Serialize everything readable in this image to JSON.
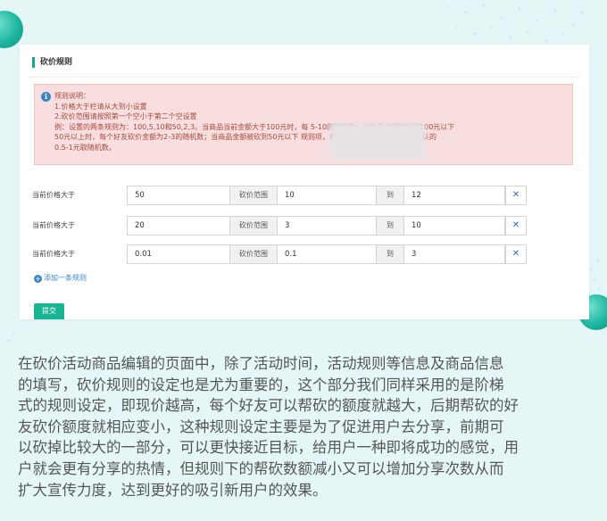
{
  "panel": {
    "title": "砍价规则",
    "notice_lines": [
      "规则说明：",
      "1.价格大于栏请从大到小设置",
      "2.砍价范围请按照第一个空小于第二个空设置",
      "例：设置的两条规则为：100,5,10和50,2,3。当商品当前金额大于100元时，每                            5-10的随机数；当商品金额被砍到100元以下",
      "50元以上时，每个好友砍价金额为2-3的随机数；当商品金额被砍到50元以下                            规则项，每个好友砍价金额为会按照默认的",
      "0.5-1元取随机数。"
    ]
  },
  "rules": [
    {
      "label": "当前价格大于",
      "price": "50",
      "range_label": "砍价范围",
      "min": "10",
      "to_label": "到",
      "max": "12"
    },
    {
      "label": "当前价格大于",
      "price": "20",
      "range_label": "砍价范围",
      "min": "3",
      "to_label": "到",
      "max": "10"
    },
    {
      "label": "当前价格大于",
      "price": "0.01",
      "range_label": "砍价范围",
      "min": "0.1",
      "to_label": "到",
      "max": "3"
    }
  ],
  "add_rule_label": "添加一条规则",
  "submit_label": "提交",
  "caption_lines": [
    "在砍价活动商品编辑的页面中，除了活动时间，活动规则等信息及商品信息",
    "的填写，砍价规则的设定也是尤为重要的，这个部分我们同样采用的是阶梯",
    "式的规则设定，即现价越高，每个好友可以帮砍的额度就越大，后期帮砍的好",
    "友砍价额度就相应变小，这种规则设定主要是为了促进用户去分享，前期可",
    "以砍掉比较大的一部分，可以更快接近目标，给用户一种即将成功的感觉，用",
    "户就会更有分享的热情，但规则下的帮砍数额减小又可以增加分享次数从而",
    "扩大宣传力度，达到更好的吸引新用户的效果。"
  ],
  "colors": {
    "accent": "#1ab394",
    "notice_bg": "#f8dede",
    "notice_text": "#a34a3f",
    "link": "#3a87c8"
  },
  "icons": {
    "notice": "info-circle-icon",
    "delete": "close-x-icon",
    "add": "plus-circle-icon"
  }
}
